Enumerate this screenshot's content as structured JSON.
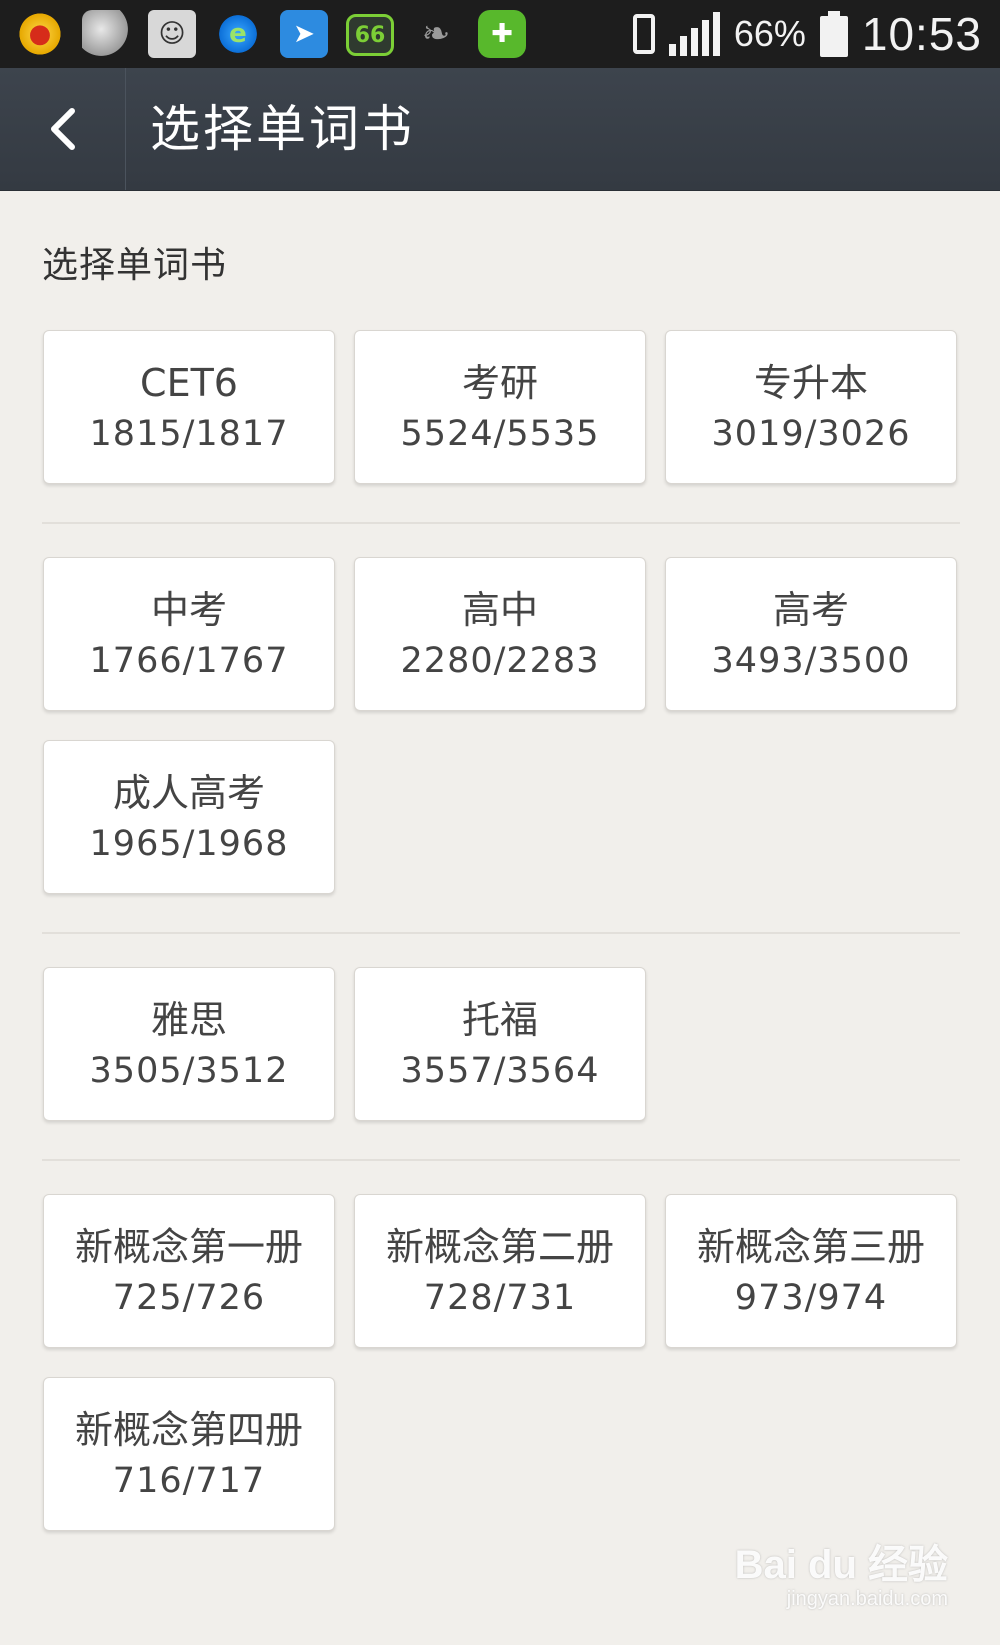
{
  "status_bar": {
    "battery_percent": "66%",
    "time": "10:53",
    "signal_level": 4,
    "app_icons": [
      "qq-icon",
      "egg-icon",
      "avatar-face-icon",
      "browser-icon",
      "message-bird-icon",
      "counter-66-icon",
      "leaf-icon",
      "plus-shield-icon"
    ],
    "counter_icon_text": "66"
  },
  "header": {
    "title": "选择单词书"
  },
  "main": {
    "section_title": "选择单词书",
    "groups": [
      {
        "books": [
          {
            "name": "CET6",
            "count": "1815/1817"
          },
          {
            "name": "考研",
            "count": "5524/5535"
          },
          {
            "name": "专升本",
            "count": "3019/3026"
          }
        ]
      },
      {
        "books": [
          {
            "name": "中考",
            "count": "1766/1767"
          },
          {
            "name": "高中",
            "count": "2280/2283"
          },
          {
            "name": "高考",
            "count": "3493/3500"
          },
          {
            "name": "成人高考",
            "count": "1965/1968"
          }
        ]
      },
      {
        "books": [
          {
            "name": "雅思",
            "count": "3505/3512"
          },
          {
            "name": "托福",
            "count": "3557/3564"
          }
        ]
      },
      {
        "books": [
          {
            "name": "新概念第一册",
            "count": "725/726"
          },
          {
            "name": "新概念第二册",
            "count": "728/731"
          },
          {
            "name": "新概念第三册",
            "count": "973/974"
          },
          {
            "name": "新概念第四册",
            "count": "716/717"
          }
        ]
      }
    ]
  },
  "watermark": {
    "main": "Bai du 经验",
    "sub": "jingyan.baidu.com"
  },
  "colors": {
    "status_bar_bg": "#1d1d1d",
    "header_bg": "#383f47",
    "page_bg": "#f1efeb",
    "card_bg": "#ffffff",
    "text": "#444444"
  }
}
